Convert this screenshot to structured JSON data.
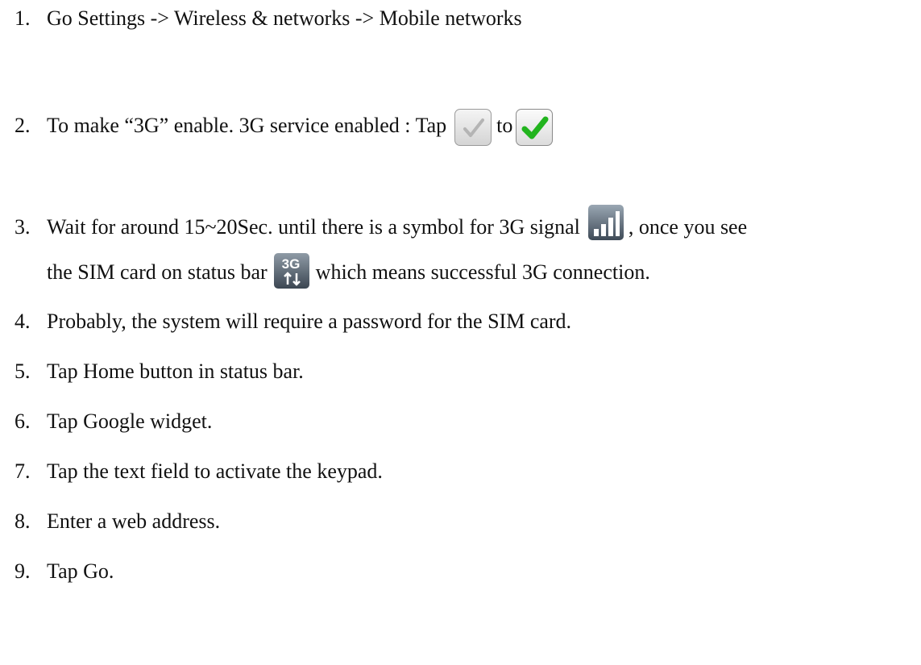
{
  "steps": [
    {
      "num": "1.",
      "text": "Go Settings -> Wireless & networks -> Mobile networks"
    },
    {
      "num": "2.",
      "text_before": "To make “3G” enable.  3G service enabled :  Tap",
      "text_middle": "to"
    },
    {
      "num": "3.",
      "text_a": "Wait for around 15~20Sec. until there is a symbol for 3G signal",
      "text_b": ", once you see",
      "text_c": "the SIM card on status bar",
      "text_d": "which means successful 3G connection."
    },
    {
      "num": "4.",
      "text": "Probably, the system will require a password for the SIM card."
    },
    {
      "num": "5.",
      "text": "Tap Home button in status bar."
    },
    {
      "num": "6.",
      "text": "Tap Google widget."
    },
    {
      "num": "7.",
      "text": "Tap the text field to activate the keypad."
    },
    {
      "num": "8.",
      "text": "Enter a web address."
    },
    {
      "num": "9.",
      "text": "Tap Go."
    }
  ],
  "icons": {
    "unchecked": "checkbox-unchecked-icon",
    "checked": "checkbox-checked-icon",
    "signal": "signal-bars-icon",
    "three_g": "3g-status-icon",
    "three_g_label": "3G"
  },
  "colors": {
    "check_green": "#22b41e",
    "check_gray": "#b4b4b4"
  }
}
